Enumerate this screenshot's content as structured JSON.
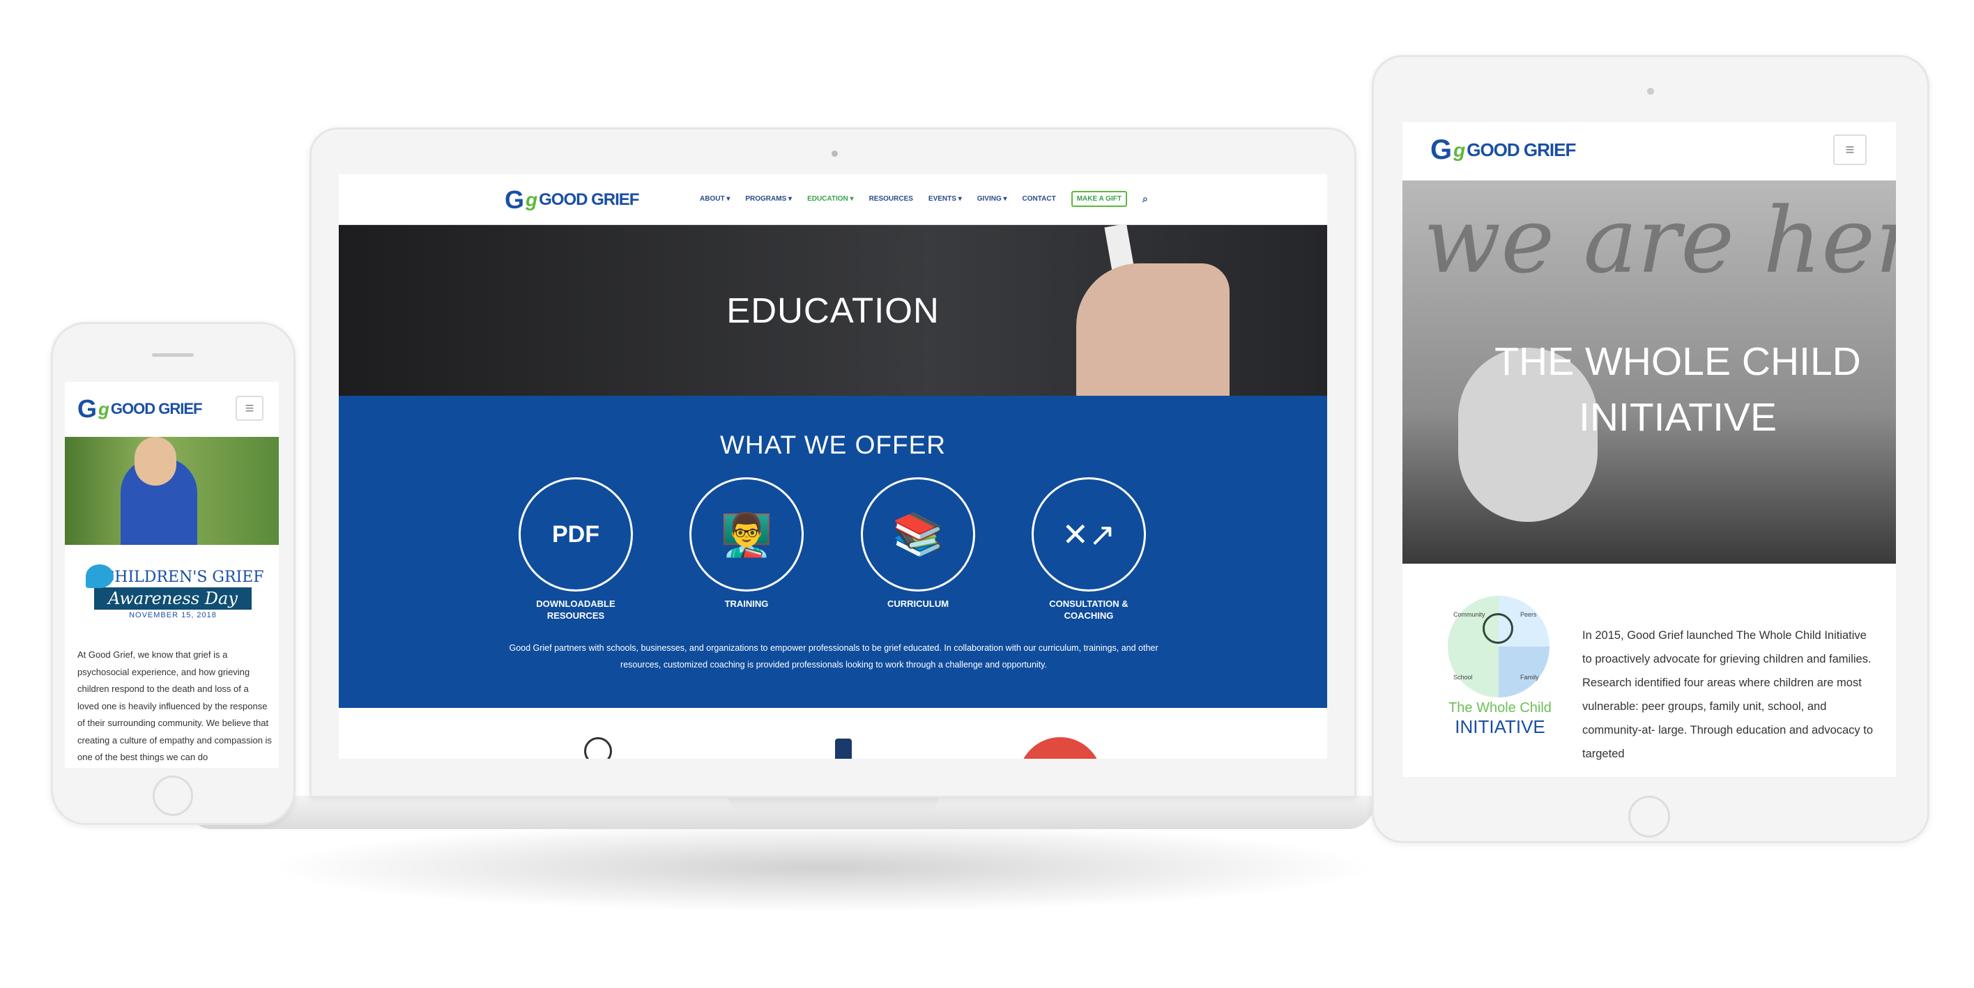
{
  "brand": {
    "g": "G",
    "g2": "g",
    "name": "GOOD GRIEF"
  },
  "laptop": {
    "nav": [
      {
        "label": "ABOUT ▾"
      },
      {
        "label": "PROGRAMS ▾"
      },
      {
        "label": "EDUCATION ▾"
      },
      {
        "label": "RESOURCES"
      },
      {
        "label": "EVENTS ▾"
      },
      {
        "label": "GIVING ▾"
      },
      {
        "label": "CONTACT"
      }
    ],
    "gift": "MAKE A GIFT",
    "search_icon": "⌕",
    "hero_title": "EDUCATION",
    "offer_title": "WHAT WE OFFER",
    "offers": [
      {
        "icon": "PDF",
        "label": "DOWNLOADABLE RESOURCES"
      },
      {
        "icon": "👨‍🏫",
        "label": "TRAINING"
      },
      {
        "icon": "📚",
        "label": "CURRICULUM"
      },
      {
        "icon": "✕↗",
        "label": "CONSULTATION & COACHING"
      }
    ],
    "paragraph": "Good Grief partners with schools, businesses, and organizations to empower professionals to be grief educated. In collaboration with our curriculum, trainings, and other resources, customized coaching is provided professionals looking to work through a challenge and opportunity."
  },
  "phone": {
    "banner_title": "CHILDREN'S GRIEF",
    "banner_ribbon": "Awareness Day",
    "banner_date": "NOVEMBER 15, 2018",
    "text": "At Good Grief, we know that grief is a psychosocial experience, and how grieving children respond to the death and loss of a loved one is heavily influenced by the response of their surrounding community. We believe that creating a culture of empathy and compassion is one of the best things we can do"
  },
  "tablet": {
    "hero_text": "we are her",
    "hero_title": "THE WHOLE CHILD INITIATIVE",
    "logo_labels": [
      "Community",
      "Peers",
      "School",
      "Family"
    ],
    "logo_line1": "The Whole Child",
    "logo_line2": "INITIATIVE",
    "text": "In 2015, Good Grief launched The Whole Child Initiative to proactively advocate for grieving children and families. Research identified four areas where children are most vulnerable: peer groups, family unit, school, and community-at- large. Through education and advocacy to targeted"
  },
  "menu_icon": "≡"
}
